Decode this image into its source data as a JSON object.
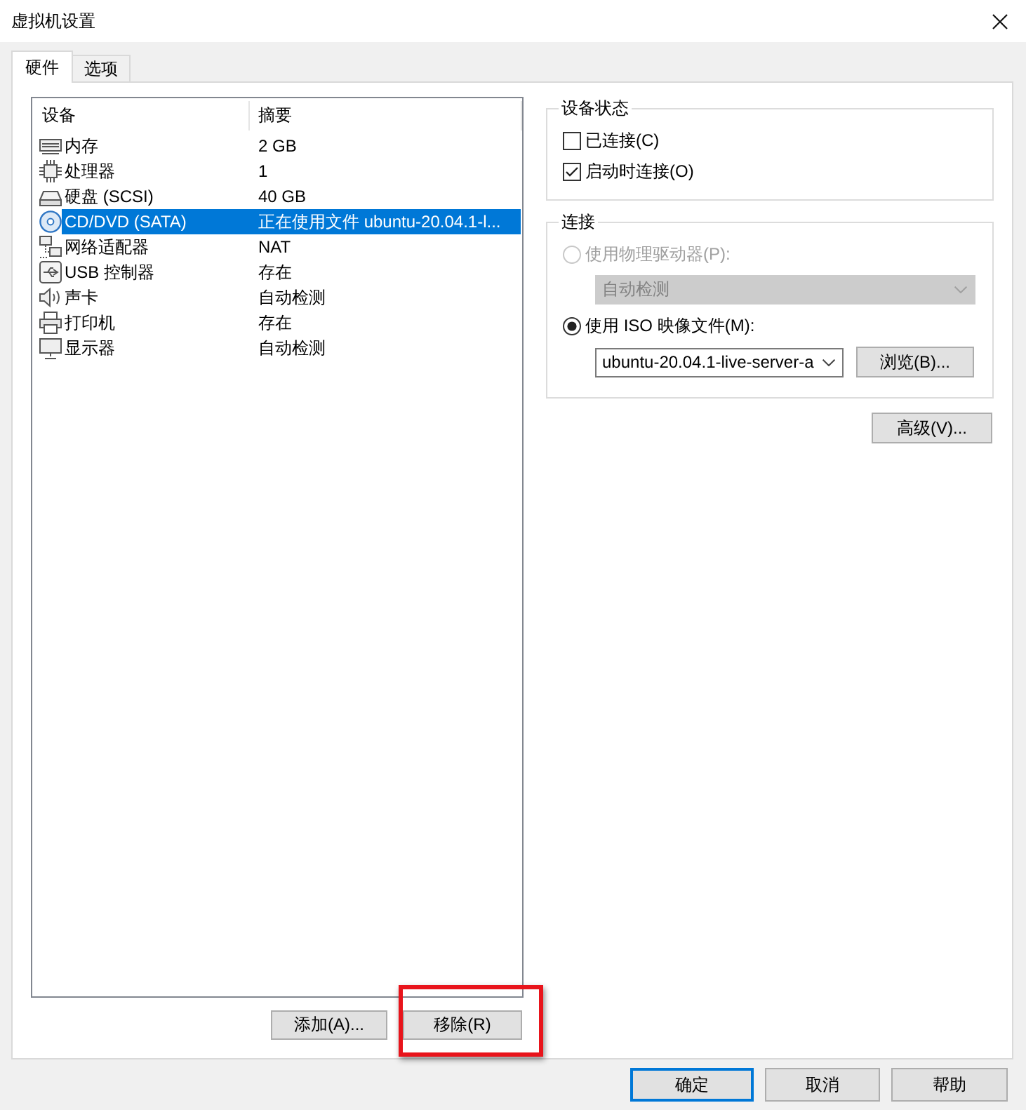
{
  "window": {
    "title": "虚拟机设置"
  },
  "tabs": [
    {
      "label": "硬件",
      "selected": true
    },
    {
      "label": "选项",
      "selected": false
    }
  ],
  "device_list": {
    "columns": [
      "设备",
      "摘要"
    ],
    "rows": [
      {
        "kind": "memory",
        "device": "内存",
        "summary": "2 GB",
        "selected": false
      },
      {
        "kind": "processor",
        "device": "处理器",
        "summary": "1",
        "selected": false
      },
      {
        "kind": "disk",
        "device": "硬盘 (SCSI)",
        "summary": "40 GB",
        "selected": false
      },
      {
        "kind": "cdrom",
        "device": "CD/DVD (SATA)",
        "summary": "正在使用文件 ubuntu-20.04.1-l...",
        "selected": true
      },
      {
        "kind": "network",
        "device": "网络适配器",
        "summary": "NAT",
        "selected": false
      },
      {
        "kind": "usb",
        "device": "USB 控制器",
        "summary": "存在",
        "selected": false
      },
      {
        "kind": "sound",
        "device": "声卡",
        "summary": "自动检测",
        "selected": false
      },
      {
        "kind": "printer",
        "device": "打印机",
        "summary": "存在",
        "selected": false
      },
      {
        "kind": "display",
        "device": "显示器",
        "summary": "自动检测",
        "selected": false
      }
    ]
  },
  "list_buttons": [
    {
      "label": "添加(A)...",
      "highlighted": false
    },
    {
      "label": "移除(R)",
      "highlighted": true
    }
  ],
  "device_status": {
    "title": "设备状态",
    "checkboxes": [
      {
        "label": "已连接(C)",
        "checked": false
      },
      {
        "label": "启动时连接(O)",
        "checked": true
      }
    ]
  },
  "connection": {
    "title": "连接",
    "options": [
      {
        "label": "使用物理驱动器(P):",
        "selected": false,
        "disabled": true,
        "field": {
          "value": "自动检测",
          "disabled": true
        }
      },
      {
        "label": "使用 ISO 映像文件(M):",
        "selected": true,
        "disabled": false,
        "field": {
          "value": "ubuntu-20.04.1-live-server-a",
          "disabled": false
        },
        "button": "浏览(B)..."
      }
    ]
  },
  "advanced_button": "高级(V)...",
  "dialog_buttons": [
    {
      "label": "确定",
      "default": true
    },
    {
      "label": "取消",
      "default": false
    },
    {
      "label": "帮助",
      "default": false
    }
  ]
}
